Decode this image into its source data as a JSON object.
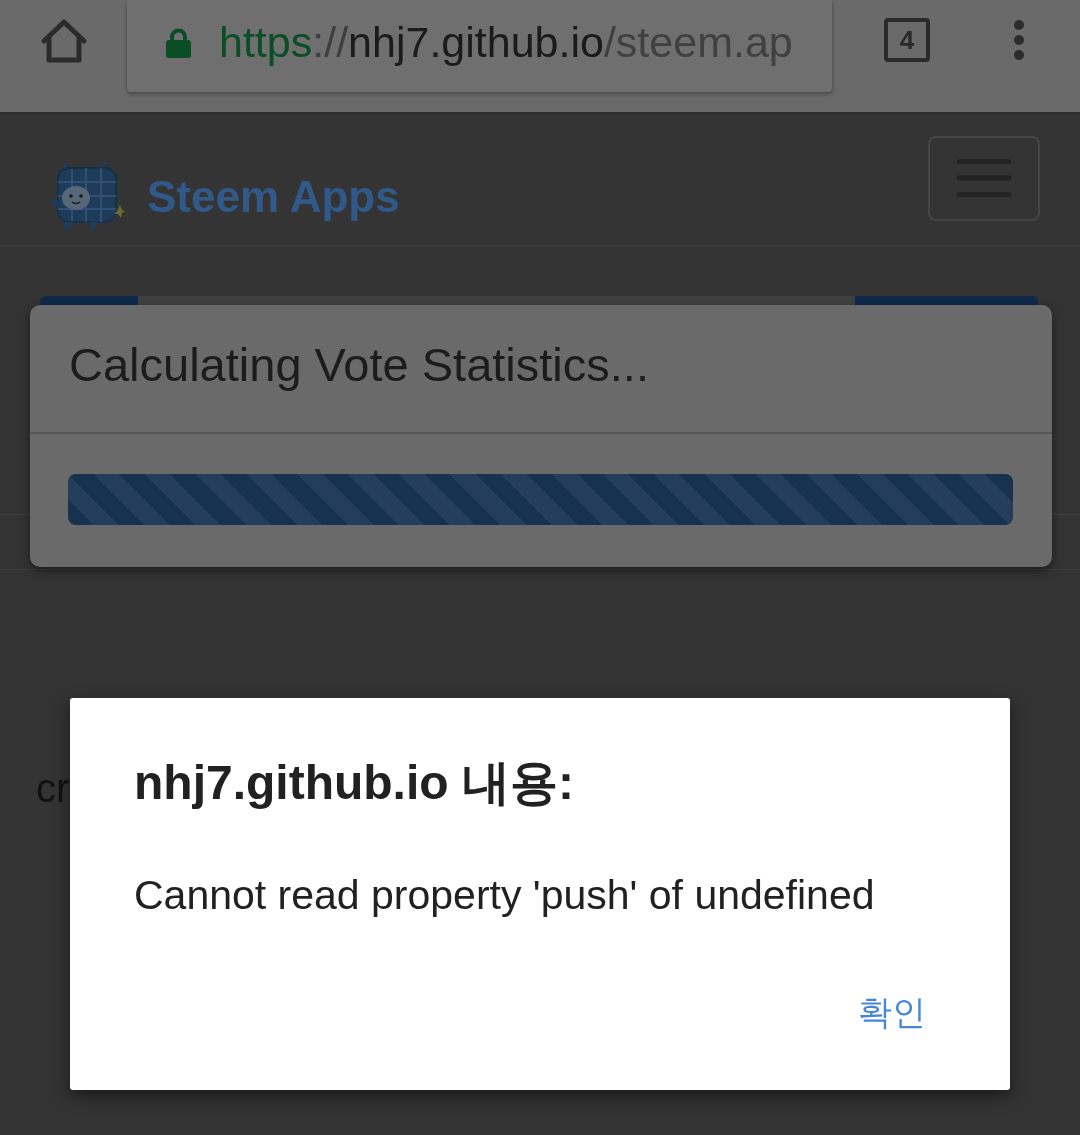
{
  "browser": {
    "secure": true,
    "url": {
      "scheme": "https",
      "separator": "://",
      "host": "nhj7.github.io",
      "path": "/steem.ap"
    },
    "tab_count": "4"
  },
  "navbar": {
    "brand": "Steem Apps"
  },
  "loading_modal": {
    "title": "Calculating Vote Statistics...",
    "progress": {
      "level": 1
    }
  },
  "background_text": "cr",
  "alert": {
    "title": "nhj7.github.io 내용:",
    "message": "Cannot read property 'push' of undefined",
    "button": "확인"
  }
}
